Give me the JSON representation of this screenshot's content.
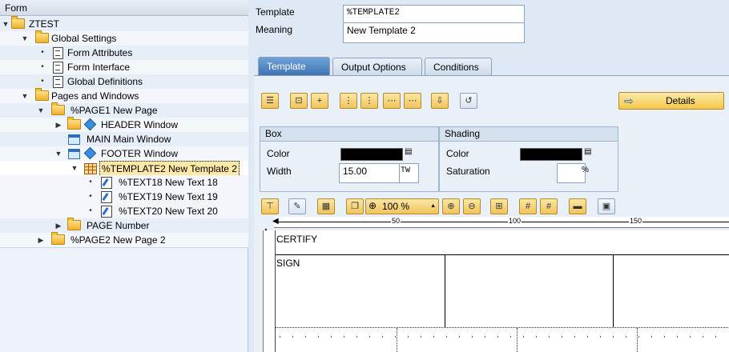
{
  "tree": {
    "header": "Form",
    "nodes": [
      {
        "label": "ZTEST"
      },
      {
        "label": "Global Settings"
      },
      {
        "label": "Form Attributes"
      },
      {
        "label": "Form Interface"
      },
      {
        "label": "Global Definitions"
      },
      {
        "label": "Pages and Windows"
      },
      {
        "label": "%PAGE1 New Page"
      },
      {
        "label": "HEADER Window"
      },
      {
        "label": "MAIN Main Window"
      },
      {
        "label": "FOOTER Window"
      },
      {
        "label": "%TEMPLATE2 New Template 2"
      },
      {
        "label": "%TEXT18 New Text 18"
      },
      {
        "label": "%TEXT19 New Text 19"
      },
      {
        "label": "%TEXT20 New Text 20"
      },
      {
        "label": "PAGE Number"
      },
      {
        "label": "%PAGE2 New Page 2"
      }
    ]
  },
  "header": {
    "template_label": "Template",
    "template_value": "%TEMPLATE2",
    "meaning_label": "Meaning",
    "meaning_value": "New Template 2"
  },
  "tabs": [
    {
      "label": "Template",
      "active": true
    },
    {
      "label": "Output Options",
      "active": false
    },
    {
      "label": "Conditions",
      "active": false
    }
  ],
  "details_label": "Details",
  "box": {
    "title": "Box",
    "color_label": "Color",
    "width_label": "Width",
    "width_value": "15.00",
    "width_unit": "TW"
  },
  "shading": {
    "title": "Shading",
    "color_label": "Color",
    "saturation_label": "Saturation",
    "saturation_value": "",
    "saturation_unit": "%"
  },
  "zoom": "100 %",
  "ruler": {
    "marks": [
      "50",
      "100",
      "150"
    ]
  },
  "canvas": {
    "cell1": "CERTIFY",
    "cell2": "SIGN"
  },
  "colors": {
    "accent": "#3f74b4",
    "selection": "#fde8a8",
    "box_color": "#000000"
  }
}
